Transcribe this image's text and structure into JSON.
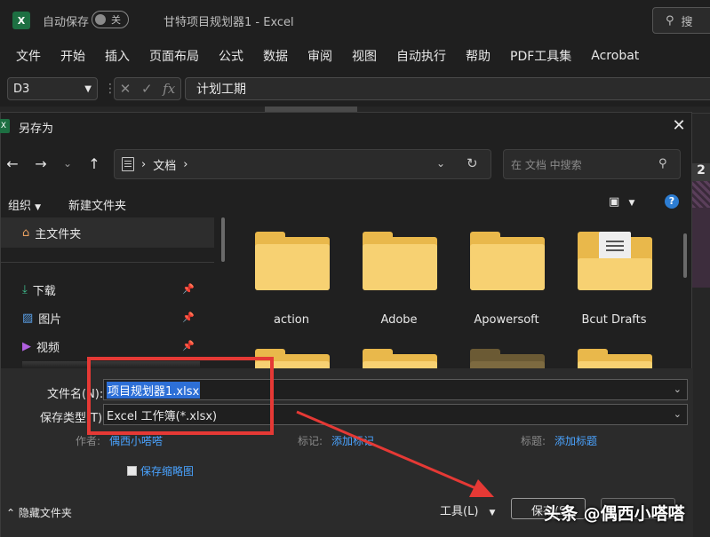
{
  "excel": {
    "autosave_label": "自动保存",
    "autosave_state": "关",
    "doc_title": "甘特项目规划器1  -  Excel",
    "search_label": "搜",
    "ribbon_tabs": [
      "文件",
      "开始",
      "插入",
      "页面布局",
      "公式",
      "数据",
      "审阅",
      "视图",
      "自动执行",
      "帮助",
      "PDF工具集",
      "Acrobat"
    ],
    "name_box": "D3",
    "formula": "计划工期",
    "sheet_column_label": "2"
  },
  "dialog": {
    "title": "另存为",
    "path_location": "文档",
    "search_placeholder": "在 文档 中搜索",
    "organize_label": "组织",
    "new_folder_label": "新建文件夹",
    "sidebar": {
      "home": "主文件夹",
      "items": [
        "下载",
        "图片",
        "视频"
      ]
    },
    "files": [
      {
        "name": "action",
        "type": "folder"
      },
      {
        "name": "Adobe",
        "type": "folder"
      },
      {
        "name": "Apowersoft",
        "type": "folder"
      },
      {
        "name": "Bcut Drafts",
        "type": "folder-doc"
      }
    ],
    "filename_label": "文件名(N):",
    "filename_value": "项目规划器1.xlsx",
    "filetype_label": "保存类型(T):",
    "filetype_value": "Excel 工作簿(*.xlsx)",
    "authors_label": "作者:",
    "authors_value": "偶西小嗒嗒",
    "tags_label": "标记:",
    "tags_value": "添加标记",
    "title_label": "标题:",
    "title_value": "添加标题",
    "thumbnail_label": "保存缩略图",
    "hide_folders_label": "隐藏文件夹",
    "tools_label": "工具(L)",
    "save_label": "保存(S)"
  },
  "watermark": "头条 @偶西小嗒嗒",
  "colors": {
    "annotation_red": "#e53935",
    "folder_yellow": "#f7d172",
    "link_blue": "#4aa3ff",
    "selection_blue": "#2d6fd6"
  }
}
